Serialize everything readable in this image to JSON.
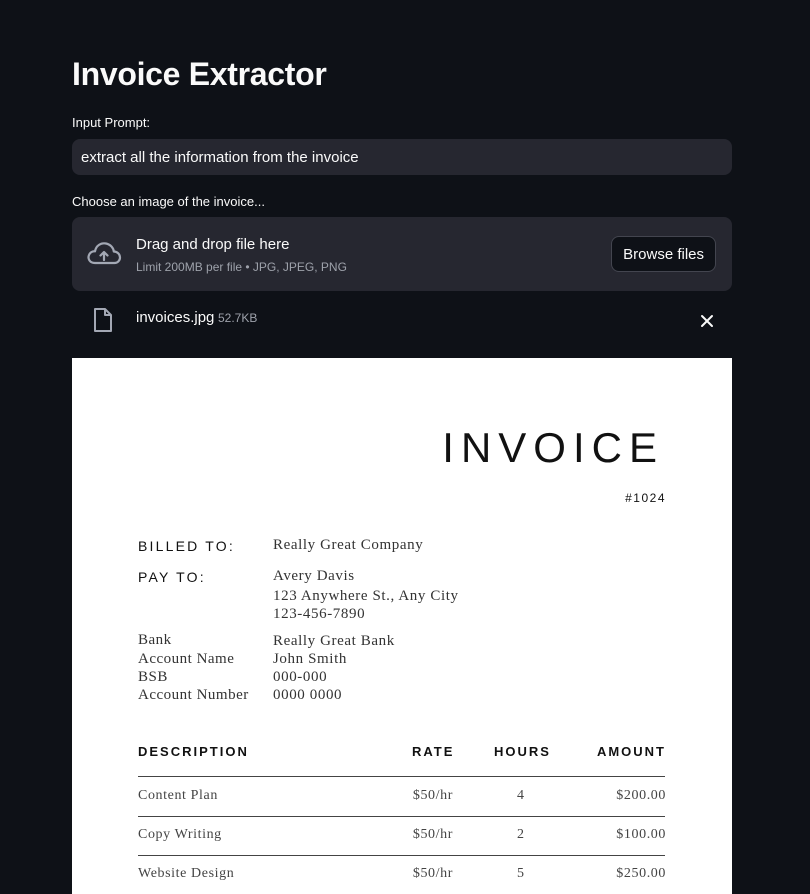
{
  "app": {
    "title": "Invoice Extractor",
    "prompt_label": "Input Prompt:",
    "prompt_value": "extract all the information from the invoice",
    "upload_label": "Choose an image of the invoice...",
    "dropzone": {
      "title": "Drag and drop file here",
      "subtitle": "Limit 200MB per file • JPG, JPEG, PNG",
      "browse_label": "Browse files"
    },
    "file": {
      "name": "invoices.jpg",
      "size": "52.7KB"
    }
  },
  "invoice": {
    "title": "INVOICE",
    "number": "#1024",
    "billed_to_label": "BILLED TO:",
    "billed_to": "Really Great Company",
    "pay_to_label": "PAY TO:",
    "pay_to_lines": [
      "Avery Davis",
      "123 Anywhere St., Any City",
      "123-456-7890"
    ],
    "bank": [
      {
        "key": "Bank",
        "value": "Really Great Bank"
      },
      {
        "key": "Account Name",
        "value": "John Smith"
      },
      {
        "key": "BSB",
        "value": "000-000"
      },
      {
        "key": "Account Number",
        "value": "0000 0000"
      }
    ],
    "headers": {
      "description": "DESCRIPTION",
      "rate": "RATE",
      "hours": "HOURS",
      "amount": "AMOUNT"
    },
    "rows": [
      {
        "description": "Content Plan",
        "rate": "$50/hr",
        "hours": "4",
        "amount": "$200.00"
      },
      {
        "description": "Copy Writing",
        "rate": "$50/hr",
        "hours": "2",
        "amount": "$100.00"
      },
      {
        "description": "Website Design",
        "rate": "$50/hr",
        "hours": "5",
        "amount": "$250.00"
      }
    ]
  },
  "colors": {
    "background": "#0e1117",
    "input_bg": "#262730",
    "text": "#fafafa",
    "muted": "#9ea2ab"
  }
}
